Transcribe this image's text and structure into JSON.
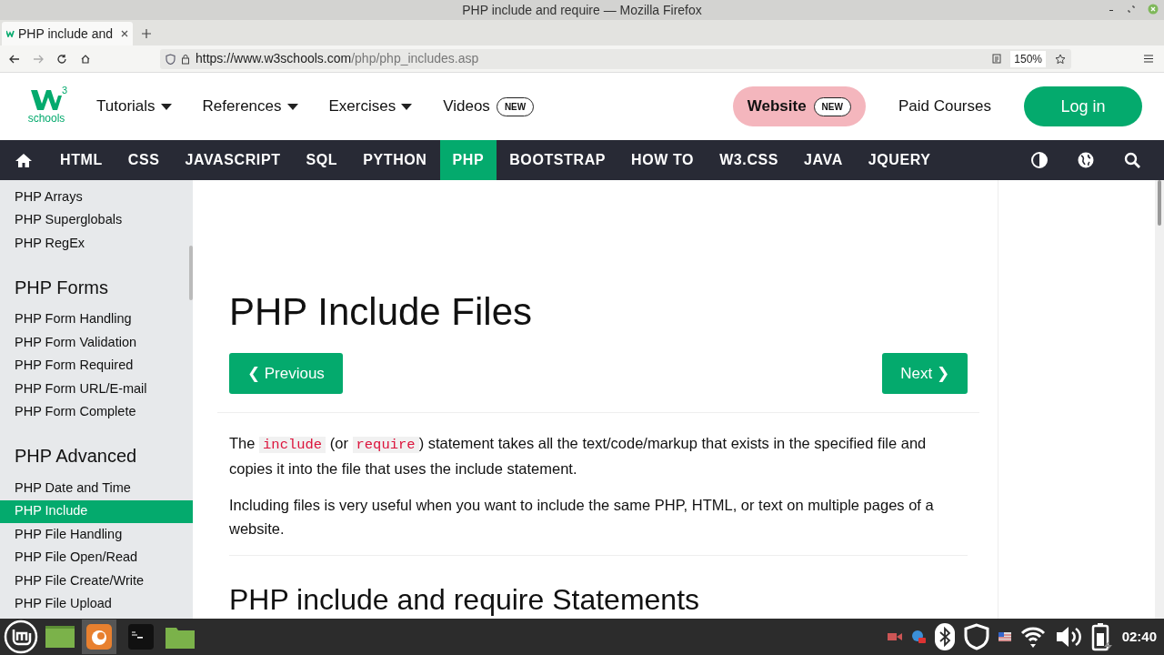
{
  "window": {
    "title": "PHP include and require — Mozilla Firefox"
  },
  "browser": {
    "tab": "PHP include and",
    "url_host": "https://www.w3schools.com",
    "url_path": "/php/php_includes.asp",
    "zoom": "150%"
  },
  "site_header": {
    "logo_sup": "3",
    "logo_text": "schools",
    "menus": [
      {
        "label": "Tutorials",
        "kind": "dropdown"
      },
      {
        "label": "References",
        "kind": "dropdown"
      },
      {
        "label": "Exercises",
        "kind": "dropdown"
      },
      {
        "label": "Videos",
        "kind": "badge",
        "badge": "NEW"
      }
    ],
    "website": {
      "label": "Website",
      "badge": "NEW"
    },
    "paid": "Paid Courses",
    "login": "Log in"
  },
  "topnav": [
    {
      "label": "HTML",
      "selected": false
    },
    {
      "label": "CSS",
      "selected": false
    },
    {
      "label": "JAVASCRIPT",
      "selected": false
    },
    {
      "label": "SQL",
      "selected": false
    },
    {
      "label": "PYTHON",
      "selected": false
    },
    {
      "label": "PHP",
      "selected": true
    },
    {
      "label": "BOOTSTRAP",
      "selected": false
    },
    {
      "label": "HOW TO",
      "selected": false
    },
    {
      "label": "W3.CSS",
      "selected": false
    },
    {
      "label": "JAVA",
      "selected": false
    },
    {
      "label": "JQUERY",
      "selected": false
    }
  ],
  "sidebar": [
    {
      "kind": "link",
      "label": "PHP Arrays",
      "selected": false
    },
    {
      "kind": "link",
      "label": "PHP Superglobals",
      "selected": false
    },
    {
      "kind": "link",
      "label": "PHP RegEx",
      "selected": false
    },
    {
      "kind": "heading",
      "label": "PHP Forms"
    },
    {
      "kind": "link",
      "label": "PHP Form Handling",
      "selected": false
    },
    {
      "kind": "link",
      "label": "PHP Form Validation",
      "selected": false
    },
    {
      "kind": "link",
      "label": "PHP Form Required",
      "selected": false
    },
    {
      "kind": "link",
      "label": "PHP Form URL/E-mail",
      "selected": false
    },
    {
      "kind": "link",
      "label": "PHP Form Complete",
      "selected": false
    },
    {
      "kind": "heading",
      "label": "PHP Advanced"
    },
    {
      "kind": "link",
      "label": "PHP Date and Time",
      "selected": false
    },
    {
      "kind": "link",
      "label": "PHP Include",
      "selected": true
    },
    {
      "kind": "link",
      "label": "PHP File Handling",
      "selected": false
    },
    {
      "kind": "link",
      "label": "PHP File Open/Read",
      "selected": false
    },
    {
      "kind": "link",
      "label": "PHP File Create/Write",
      "selected": false
    },
    {
      "kind": "link",
      "label": "PHP File Upload",
      "selected": false
    }
  ],
  "content": {
    "title": "PHP Include Files",
    "previous": "❮ Previous",
    "next": "Next ❯",
    "paragraphs": [
      [
        {
          "kind": "text",
          "text": "The "
        },
        {
          "kind": "code",
          "text": "include"
        },
        {
          "kind": "text",
          "text": " (or "
        },
        {
          "kind": "code",
          "text": "require"
        },
        {
          "kind": "text",
          "text": ") statement takes all the text/code/markup that exists in the specified file and copies it into the file that uses the include statement."
        }
      ],
      [
        {
          "kind": "text",
          "text": "Including files is very useful when you want to include the same PHP, HTML, or text on multiple pages of a website."
        }
      ]
    ],
    "subtitle": "PHP include and require Statements"
  },
  "taskbar": {
    "clock": "02:40"
  }
}
